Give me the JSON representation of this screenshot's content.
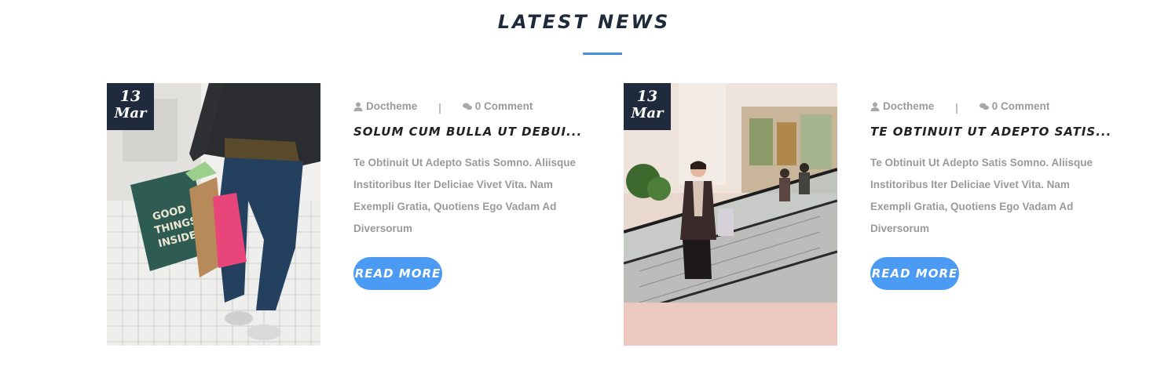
{
  "section": {
    "title": "LATEST NEWS",
    "accent": "#4a90e2"
  },
  "posts": [
    {
      "date_day": "13",
      "date_month": "Mar",
      "author": "Doctheme",
      "separator": "|",
      "comments": "0 Comment",
      "title": "SOLUM CUM BULLA UT DEBUI...",
      "excerpt": "Te Obtinuit Ut Adepto Satis Somno. Aliisque Institoribus Iter Deliciae Vivet Vita. Nam Exempli Gratia, Quotiens Ego Vadam Ad Diversorum",
      "button_label": "READ MORE",
      "image": "shopping-bags-photo"
    },
    {
      "date_day": "13",
      "date_month": "Mar",
      "author": "Doctheme",
      "separator": "|",
      "comments": "0 Comment",
      "title": "TE OBTINUIT UT ADEPTO SATIS...",
      "excerpt": "Te Obtinuit Ut Adepto Satis Somno. Aliisque Institoribus Iter Deliciae Vivet Vita. Nam Exempli Gratia, Quotiens Ego Vadam Ad Diversorum",
      "button_label": "READ MORE",
      "image": "mall-escalator-photo"
    }
  ],
  "colors": {
    "badge": "#1f2b3c",
    "button": "#4b9bf5",
    "meta_text": "#9a9a9a",
    "title_text": "#222222"
  }
}
